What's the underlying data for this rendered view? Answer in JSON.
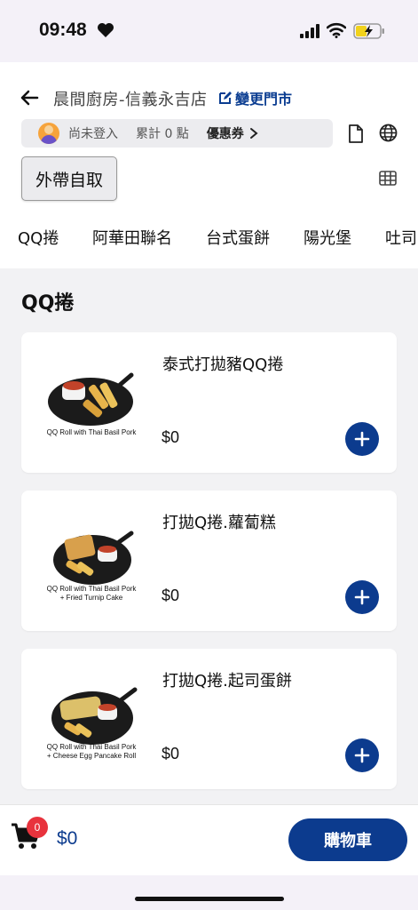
{
  "status_bar": {
    "time": "09:48"
  },
  "header": {
    "store_name": "晨間廚房-信義永吉店",
    "change_store_label": "變更門市",
    "member": {
      "login_status": "尚未登入",
      "points": "累計 0 點",
      "coupon_label": "優惠券"
    },
    "order_mode_label": "外帶自取"
  },
  "categories": [
    "QQ捲",
    "阿華田聯名",
    "台式蛋餅",
    "陽光堡",
    "吐司"
  ],
  "section": {
    "title": "QQ捲",
    "products": [
      {
        "name": "泰式打拋豬QQ捲",
        "price": "$0",
        "caption": "QQ Roll with Thai Basil Pork"
      },
      {
        "name": "打拋Q捲.蘿蔔糕",
        "price": "$0",
        "caption": "QQ Roll with Thai Basil Pork\n+ Fried Turnip Cake"
      },
      {
        "name": "打拋Q捲.起司蛋餅",
        "price": "$0",
        "caption": "QQ Roll with Thai Basil Pork\n+ Cheese Egg Pancake Roll"
      }
    ]
  },
  "cart": {
    "count": "0",
    "total": "$0",
    "checkout_label": "購物車"
  },
  "colors": {
    "primary": "#0c3b8e",
    "badge": "#e8333d",
    "background": "#f2f2f4"
  }
}
